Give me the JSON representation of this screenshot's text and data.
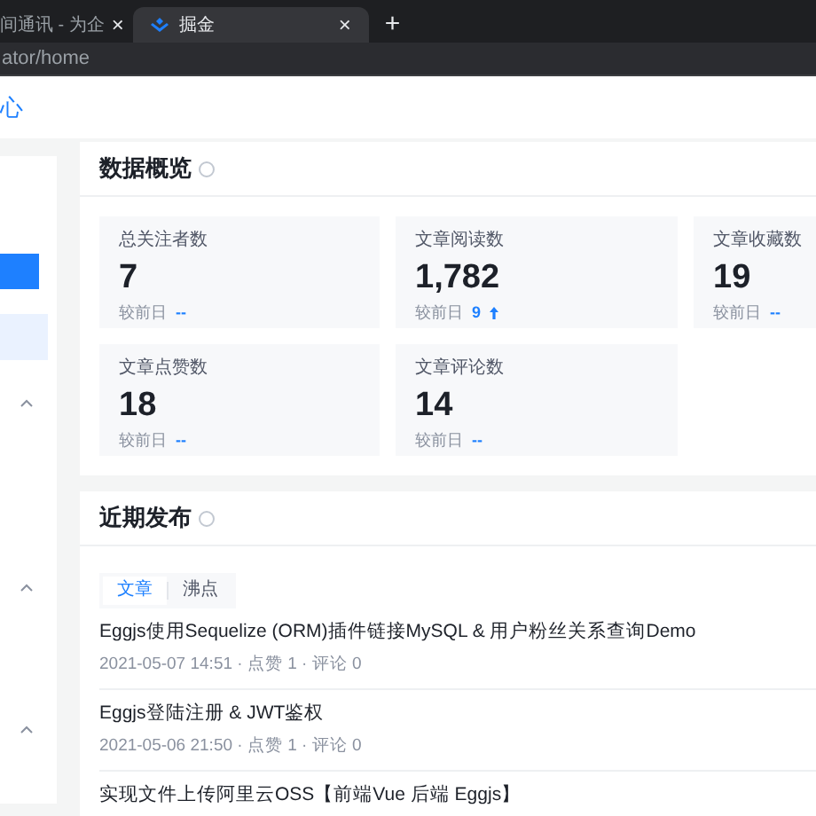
{
  "browser": {
    "tabs": [
      {
        "label": "间通讯 - 为企",
        "selected": false,
        "close": "×"
      },
      {
        "label": "掘金",
        "selected": true,
        "close": "×"
      }
    ],
    "new_tab": "+",
    "address": "ator/home"
  },
  "header": {
    "title": "心"
  },
  "sidebar": {
    "items": [
      {
        "kind": "button"
      },
      {
        "kind": "item",
        "selected": true
      },
      {
        "kind": "group",
        "expanded": true
      },
      {
        "kind": "group",
        "expanded": true
      },
      {
        "kind": "group",
        "expanded": true
      }
    ]
  },
  "overview": {
    "title": "数据概览",
    "stats": [
      {
        "label": "总关注者数",
        "value": "7",
        "compare": "较前日",
        "change": "--",
        "rising": false
      },
      {
        "label": "文章阅读数",
        "value": "1,782",
        "compare": "较前日",
        "change": "9",
        "rising": true
      },
      {
        "label": "文章收藏数",
        "value": "19",
        "compare": "较前日",
        "change": "--",
        "rising": false
      },
      {
        "label": "文章点赞数",
        "value": "18",
        "compare": "较前日",
        "change": "--",
        "rising": false
      },
      {
        "label": "文章评论数",
        "value": "14",
        "compare": "较前日",
        "change": "--",
        "rising": false
      }
    ]
  },
  "recent": {
    "title": "近期发布",
    "tabs": [
      {
        "label": "文章",
        "selected": true
      },
      {
        "label": "沸点",
        "selected": false
      }
    ],
    "articles": [
      {
        "title": "Eggjs使用Sequelize (ORM)插件链接MySQL & 用户粉丝关系查询Demo",
        "meta": "2021-05-07 14:51 · 点赞 1 · 评论 0"
      },
      {
        "title": "Eggjs登陆注册 & JWT鉴权",
        "meta": "2021-05-06 21:50 · 点赞 1 · 评论 0"
      },
      {
        "title": "实现文件上传阿里云OSS【前端Vue 后端 Eggjs】"
      }
    ]
  }
}
